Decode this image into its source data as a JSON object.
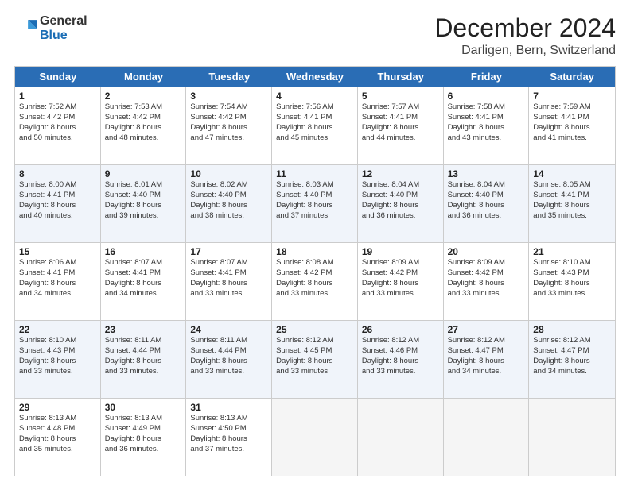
{
  "header": {
    "logo_general": "General",
    "logo_blue": "Blue",
    "month_title": "December 2024",
    "location": "Darligen, Bern, Switzerland"
  },
  "weekdays": [
    "Sunday",
    "Monday",
    "Tuesday",
    "Wednesday",
    "Thursday",
    "Friday",
    "Saturday"
  ],
  "rows": [
    [
      {
        "day": "1",
        "lines": [
          "Sunrise: 7:52 AM",
          "Sunset: 4:42 PM",
          "Daylight: 8 hours",
          "and 50 minutes."
        ]
      },
      {
        "day": "2",
        "lines": [
          "Sunrise: 7:53 AM",
          "Sunset: 4:42 PM",
          "Daylight: 8 hours",
          "and 48 minutes."
        ]
      },
      {
        "day": "3",
        "lines": [
          "Sunrise: 7:54 AM",
          "Sunset: 4:42 PM",
          "Daylight: 8 hours",
          "and 47 minutes."
        ]
      },
      {
        "day": "4",
        "lines": [
          "Sunrise: 7:56 AM",
          "Sunset: 4:41 PM",
          "Daylight: 8 hours",
          "and 45 minutes."
        ]
      },
      {
        "day": "5",
        "lines": [
          "Sunrise: 7:57 AM",
          "Sunset: 4:41 PM",
          "Daylight: 8 hours",
          "and 44 minutes."
        ]
      },
      {
        "day": "6",
        "lines": [
          "Sunrise: 7:58 AM",
          "Sunset: 4:41 PM",
          "Daylight: 8 hours",
          "and 43 minutes."
        ]
      },
      {
        "day": "7",
        "lines": [
          "Sunrise: 7:59 AM",
          "Sunset: 4:41 PM",
          "Daylight: 8 hours",
          "and 41 minutes."
        ]
      }
    ],
    [
      {
        "day": "8",
        "lines": [
          "Sunrise: 8:00 AM",
          "Sunset: 4:41 PM",
          "Daylight: 8 hours",
          "and 40 minutes."
        ]
      },
      {
        "day": "9",
        "lines": [
          "Sunrise: 8:01 AM",
          "Sunset: 4:40 PM",
          "Daylight: 8 hours",
          "and 39 minutes."
        ]
      },
      {
        "day": "10",
        "lines": [
          "Sunrise: 8:02 AM",
          "Sunset: 4:40 PM",
          "Daylight: 8 hours",
          "and 38 minutes."
        ]
      },
      {
        "day": "11",
        "lines": [
          "Sunrise: 8:03 AM",
          "Sunset: 4:40 PM",
          "Daylight: 8 hours",
          "and 37 minutes."
        ]
      },
      {
        "day": "12",
        "lines": [
          "Sunrise: 8:04 AM",
          "Sunset: 4:40 PM",
          "Daylight: 8 hours",
          "and 36 minutes."
        ]
      },
      {
        "day": "13",
        "lines": [
          "Sunrise: 8:04 AM",
          "Sunset: 4:40 PM",
          "Daylight: 8 hours",
          "and 36 minutes."
        ]
      },
      {
        "day": "14",
        "lines": [
          "Sunrise: 8:05 AM",
          "Sunset: 4:41 PM",
          "Daylight: 8 hours",
          "and 35 minutes."
        ]
      }
    ],
    [
      {
        "day": "15",
        "lines": [
          "Sunrise: 8:06 AM",
          "Sunset: 4:41 PM",
          "Daylight: 8 hours",
          "and 34 minutes."
        ]
      },
      {
        "day": "16",
        "lines": [
          "Sunrise: 8:07 AM",
          "Sunset: 4:41 PM",
          "Daylight: 8 hours",
          "and 34 minutes."
        ]
      },
      {
        "day": "17",
        "lines": [
          "Sunrise: 8:07 AM",
          "Sunset: 4:41 PM",
          "Daylight: 8 hours",
          "and 33 minutes."
        ]
      },
      {
        "day": "18",
        "lines": [
          "Sunrise: 8:08 AM",
          "Sunset: 4:42 PM",
          "Daylight: 8 hours",
          "and 33 minutes."
        ]
      },
      {
        "day": "19",
        "lines": [
          "Sunrise: 8:09 AM",
          "Sunset: 4:42 PM",
          "Daylight: 8 hours",
          "and 33 minutes."
        ]
      },
      {
        "day": "20",
        "lines": [
          "Sunrise: 8:09 AM",
          "Sunset: 4:42 PM",
          "Daylight: 8 hours",
          "and 33 minutes."
        ]
      },
      {
        "day": "21",
        "lines": [
          "Sunrise: 8:10 AM",
          "Sunset: 4:43 PM",
          "Daylight: 8 hours",
          "and 33 minutes."
        ]
      }
    ],
    [
      {
        "day": "22",
        "lines": [
          "Sunrise: 8:10 AM",
          "Sunset: 4:43 PM",
          "Daylight: 8 hours",
          "and 33 minutes."
        ]
      },
      {
        "day": "23",
        "lines": [
          "Sunrise: 8:11 AM",
          "Sunset: 4:44 PM",
          "Daylight: 8 hours",
          "and 33 minutes."
        ]
      },
      {
        "day": "24",
        "lines": [
          "Sunrise: 8:11 AM",
          "Sunset: 4:44 PM",
          "Daylight: 8 hours",
          "and 33 minutes."
        ]
      },
      {
        "day": "25",
        "lines": [
          "Sunrise: 8:12 AM",
          "Sunset: 4:45 PM",
          "Daylight: 8 hours",
          "and 33 minutes."
        ]
      },
      {
        "day": "26",
        "lines": [
          "Sunrise: 8:12 AM",
          "Sunset: 4:46 PM",
          "Daylight: 8 hours",
          "and 33 minutes."
        ]
      },
      {
        "day": "27",
        "lines": [
          "Sunrise: 8:12 AM",
          "Sunset: 4:47 PM",
          "Daylight: 8 hours",
          "and 34 minutes."
        ]
      },
      {
        "day": "28",
        "lines": [
          "Sunrise: 8:12 AM",
          "Sunset: 4:47 PM",
          "Daylight: 8 hours",
          "and 34 minutes."
        ]
      }
    ],
    [
      {
        "day": "29",
        "lines": [
          "Sunrise: 8:13 AM",
          "Sunset: 4:48 PM",
          "Daylight: 8 hours",
          "and 35 minutes."
        ]
      },
      {
        "day": "30",
        "lines": [
          "Sunrise: 8:13 AM",
          "Sunset: 4:49 PM",
          "Daylight: 8 hours",
          "and 36 minutes."
        ]
      },
      {
        "day": "31",
        "lines": [
          "Sunrise: 8:13 AM",
          "Sunset: 4:50 PM",
          "Daylight: 8 hours",
          "and 37 minutes."
        ]
      },
      null,
      null,
      null,
      null
    ]
  ]
}
